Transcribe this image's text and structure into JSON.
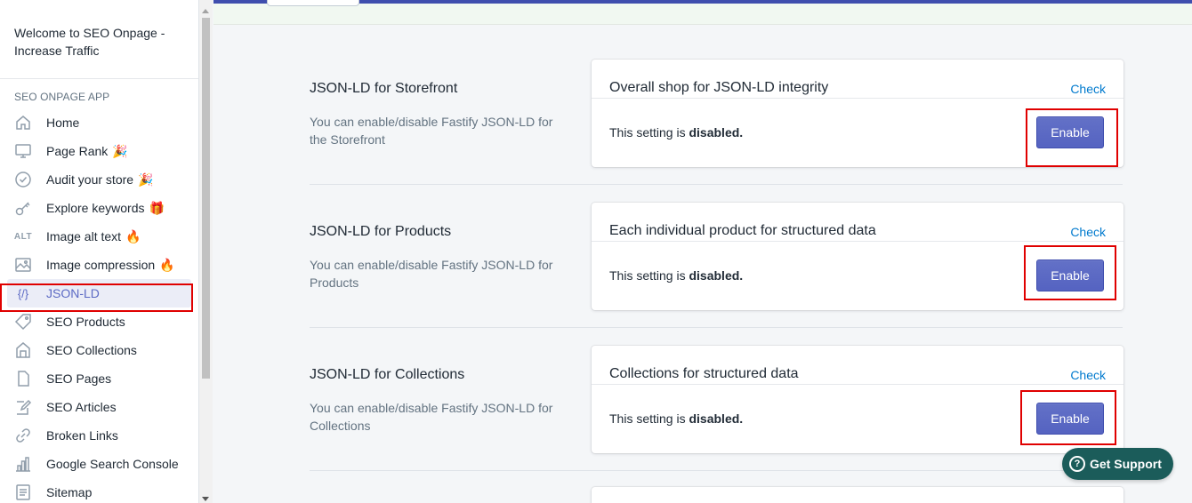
{
  "app": {
    "title": "Welcome to SEO Onpage - Increase Traffic",
    "section_label": "SEO ONPAGE APP"
  },
  "sidebar": {
    "items": [
      {
        "label": "Home",
        "icon": "home-icon",
        "emoji": ""
      },
      {
        "label": "Page Rank",
        "icon": "monitor-icon",
        "emoji": "🎉"
      },
      {
        "label": "Audit your store",
        "icon": "check-circle-icon",
        "emoji": "🎉"
      },
      {
        "label": "Explore keywords",
        "icon": "key-icon",
        "emoji": "🎁"
      },
      {
        "label": "Image alt text",
        "icon": "alt-text-icon",
        "icon_text": "ALT",
        "emoji": "🔥"
      },
      {
        "label": "Image compression",
        "icon": "image-icon",
        "emoji": "🔥"
      },
      {
        "label": "JSON-LD",
        "icon": "code-braces-icon",
        "icon_text": "{/}",
        "emoji": "",
        "active": true
      },
      {
        "label": "SEO Products",
        "icon": "tag-icon",
        "emoji": ""
      },
      {
        "label": "SEO Collections",
        "icon": "collections-icon",
        "emoji": ""
      },
      {
        "label": "SEO Pages",
        "icon": "page-icon",
        "emoji": ""
      },
      {
        "label": "SEO Articles",
        "icon": "edit-icon",
        "emoji": ""
      },
      {
        "label": "Broken Links",
        "icon": "link-icon",
        "emoji": ""
      },
      {
        "label": "Google Search Console",
        "icon": "analytics-icon",
        "emoji": ""
      },
      {
        "label": "Sitemap",
        "icon": "list-icon",
        "emoji": ""
      }
    ]
  },
  "sections": [
    {
      "title": "JSON-LD for Storefront",
      "description": "You can enable/disable Fastify JSON-LD for the Storefront",
      "card_title": "Overall shop for JSON-LD integrity",
      "check_label": "Check",
      "status_prefix": "This setting is",
      "status_value": "disabled.",
      "button_label": "Enable"
    },
    {
      "title": "JSON-LD for Products",
      "description": "You can enable/disable Fastify JSON-LD for Products",
      "card_title": "Each individual product for structured data",
      "check_label": "Check",
      "status_prefix": "This setting is",
      "status_value": "disabled.",
      "button_label": "Enable"
    },
    {
      "title": "JSON-LD for Collections",
      "description": "You can enable/disable Fastify JSON-LD for Collections",
      "card_title": "Collections for structured data",
      "check_label": "Check",
      "status_prefix": "This setting is",
      "status_value": "disabled.",
      "button_label": "Enable"
    }
  ],
  "support": {
    "label": "Get Support",
    "icon": "question-icon",
    "color": "#1b5c5a"
  },
  "colors": {
    "accent": "#5c6ac4",
    "highlight": "#e00000",
    "link": "#007ace"
  }
}
